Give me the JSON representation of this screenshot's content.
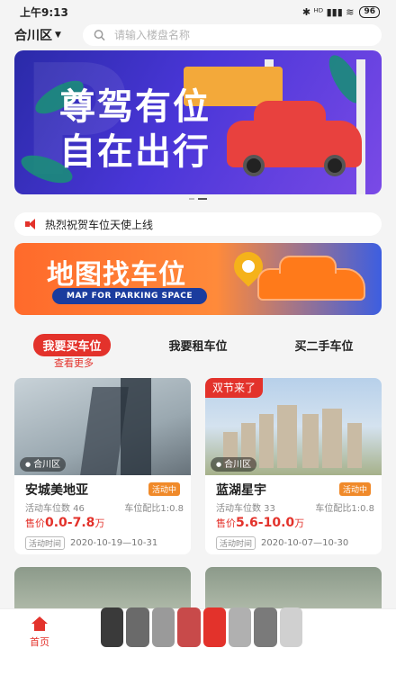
{
  "status": {
    "time": "上午9:13",
    "icons": "✱ ᴴᴰ ▮▮▮ ≋",
    "battery": "96"
  },
  "topbar": {
    "region": "合川区",
    "search_placeholder": "请输入楼盘名称"
  },
  "banner": {
    "line1": "尊驾有位",
    "line2": "自在出行"
  },
  "notice": {
    "text": "热烈祝贺车位天使上线"
  },
  "map_banner": {
    "title": "地图找车位",
    "subtitle": "MAP FOR PARKING SPACE"
  },
  "tabs": [
    {
      "label": "我要买车位",
      "active": true
    },
    {
      "label": "我要租车位",
      "active": false
    },
    {
      "label": "买二手车位",
      "active": false
    }
  ],
  "more_link": "查看更多",
  "cards": [
    {
      "promo": "",
      "location": "合川区",
      "name": "安城美地亚",
      "badge": "活动中",
      "active_count": "活动车位数 46",
      "ratio": "车位配比1:0.8",
      "price_prefix": "售价",
      "price": "0.0-7.8",
      "price_unit": "万",
      "time_label": "活动时间",
      "time": "2020-10-19—10-31"
    },
    {
      "promo": "双节来了",
      "location": "合川区",
      "name": "蓝湖星宇",
      "badge": "活动中",
      "active_count": "活动车位数 33",
      "ratio": "车位配比1:0.8",
      "price_prefix": "售价",
      "price": "5.6-10.0",
      "price_unit": "万",
      "time_label": "活动时间",
      "time": "2020-10-07—10-30"
    }
  ],
  "tabbar": {
    "home": "首页"
  },
  "colors": {
    "accent": "#e3322b",
    "badge": "#f08a2a",
    "background": "#f4f4f4"
  }
}
